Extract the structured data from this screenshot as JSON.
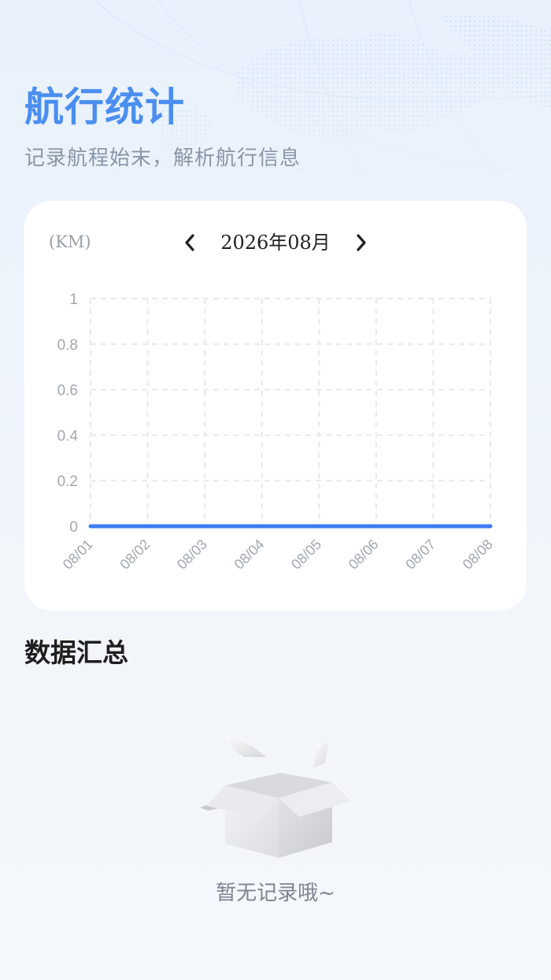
{
  "header": {
    "title": "航行统计",
    "subtitle": "记录航程始末，解析航行信息"
  },
  "chart_card": {
    "unit_label": "(KM)",
    "month_label": "2026年08月",
    "prev_icon": "chevron-left-icon",
    "next_icon": "chevron-right-icon"
  },
  "chart_data": {
    "type": "line",
    "x": [
      "08/01",
      "08/02",
      "08/03",
      "08/04",
      "08/05",
      "08/06",
      "08/07",
      "08/08"
    ],
    "series": [
      {
        "values": [
          0,
          0,
          0,
          0,
          0,
          0,
          0,
          0
        ],
        "color": "#3d7cf0"
      }
    ],
    "yticks": [
      "0",
      "0.2",
      "0.4",
      "0.6",
      "0.8",
      "1"
    ],
    "ylim": [
      0,
      1
    ],
    "ylabel": "(KM)",
    "grid": true,
    "grid_style": "dashed"
  },
  "summary": {
    "title": "数据汇总",
    "empty_text": "暂无记录哦~",
    "empty_icon": "empty-box-icon"
  },
  "colors": {
    "accent": "#4a8ef0",
    "line": "#3d7cf0",
    "grid": "#e6e9ee",
    "axis_text": "#a2a7ae"
  }
}
